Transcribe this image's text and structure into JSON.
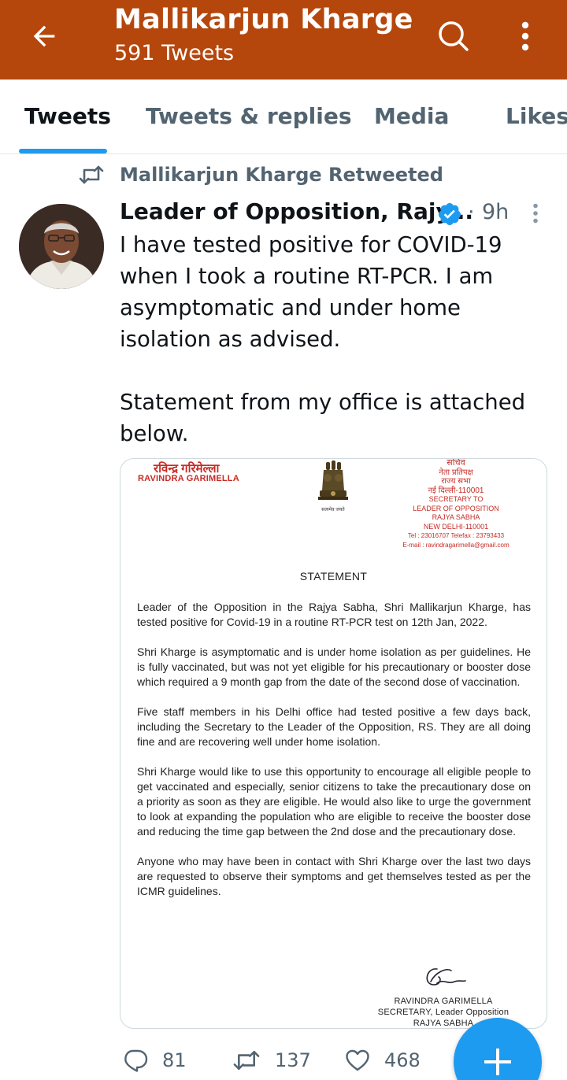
{
  "header": {
    "title": "Mallikarjun Kharge",
    "subtitle": "591 Tweets",
    "brand_color": "#b5470c",
    "icons": [
      "back-arrow-icon",
      "search-icon",
      "more-vertical-icon"
    ]
  },
  "tabs": [
    {
      "label": "Tweets",
      "active": true
    },
    {
      "label": "Tweets & replies",
      "active": false
    },
    {
      "label": "Media",
      "active": false
    },
    {
      "label": "Likes",
      "active": false
    }
  ],
  "tweet": {
    "retweet_label": "Mallikarjun Kharge Retweeted",
    "author_name": "Leader of Opposition, Rajy...",
    "verified": true,
    "separator": "·",
    "time": "9h",
    "text_para1": "I have tested positive for COVID-19 when I took a routine RT-PCR. I am asymptomatic and under home isolation as advised.",
    "text_para2": "Statement from my office is attached below.",
    "stats": {
      "replies": "81",
      "retweets": "137",
      "likes": "468"
    }
  },
  "letter": {
    "name_hindi": "रविन्द्र गरिमेल्ला",
    "name": "RAVINDRA GARIMELLA",
    "emblem_caption": "सत्यमेव जयते",
    "right_lines": [
      "सचिव",
      "नेता प्रतिपक्ष",
      "राज्य सभा",
      "नई दिल्ली-110001",
      "SECRETARY TO",
      "LEADER OF OPPOSITION",
      "RAJYA SABHA",
      "NEW DELHI-110001",
      "Tel : 23016707 Telefax : 23793433",
      "E-mail : ravindragarimella@gmail.com"
    ],
    "title": "STATEMENT",
    "p1": "Leader of the Opposition in the Rajya Sabha, Shri Mallikarjun Kharge, has tested positive for Covid-19 in a routine RT-PCR test on 12th Jan, 2022.",
    "p2": "Shri Kharge is asymptomatic and is under home isolation as per guidelines. He is fully vaccinated, but was not yet eligible for his precautionary or booster dose which required a 9 month gap from the date of the second dose of vaccination.",
    "p3": "Five staff members in his Delhi office had tested positive a few days back, including the Secretary to the Leader of the Opposition, RS. They are all doing fine and are recovering well under home isolation.",
    "p4": "Shri Kharge would like to use this opportunity to encourage all eligible people to get vaccinated and especially, senior citizens to take the precautionary dose on a priority as soon as they are eligible. He would also like to urge the government to look at expanding the population who are eligible to receive the booster dose and reducing the time gap between the 2nd dose and the precautionary dose.",
    "p5": "Anyone who may have been in contact with Shri Kharge over the last two days are requested to observe their symptoms and get themselves tested as per the ICMR guidelines.",
    "sign_name": "RAVINDRA GARIMELLA",
    "sign_title": "SECRETARY, Leader Opposition",
    "sign_org": "RAJYA SABHA"
  },
  "accent_color": "#1d9bf0"
}
